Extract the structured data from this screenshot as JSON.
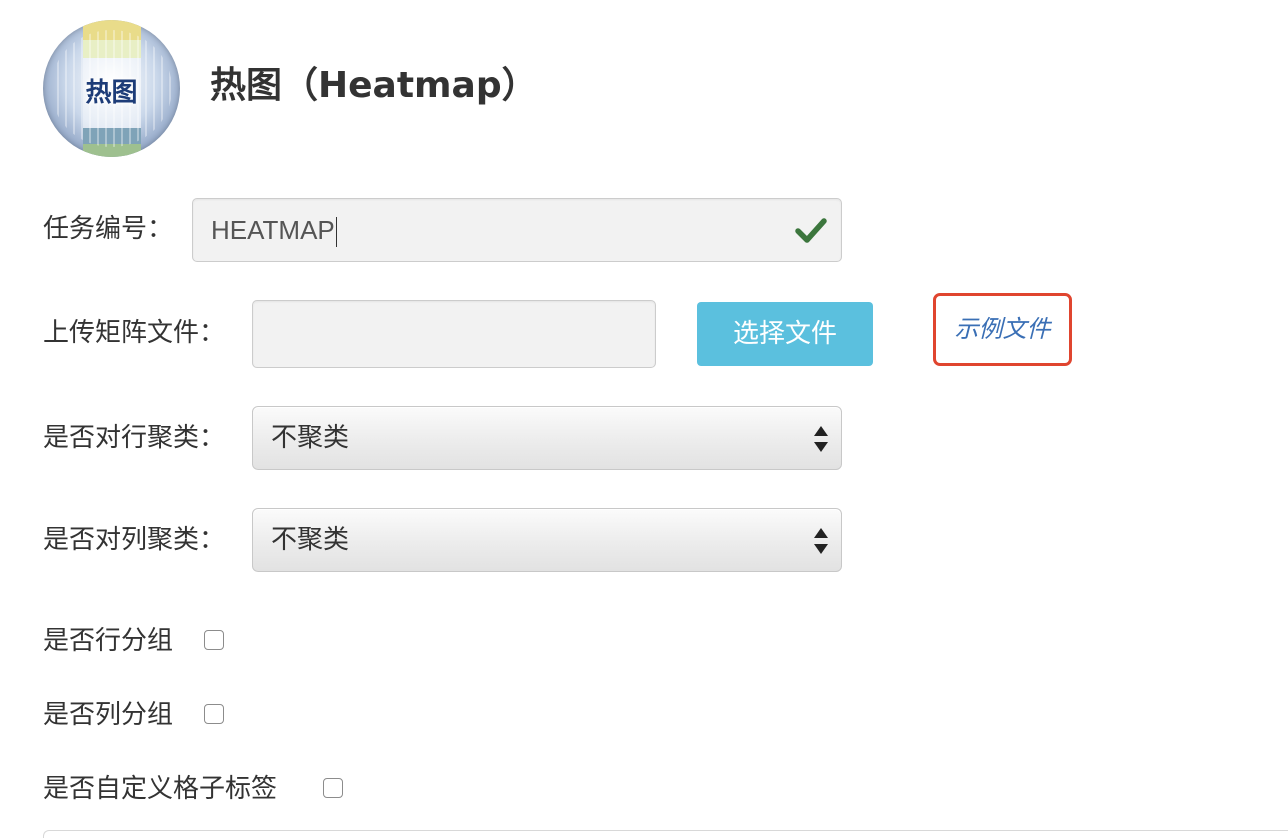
{
  "header": {
    "logo_text": "热图",
    "title": "热图（Heatmap）"
  },
  "form": {
    "task": {
      "label": "任务编号：",
      "value": "HEATMAP",
      "status_icon": "check-icon",
      "status_color": "#3c763d"
    },
    "upload": {
      "label": "上传矩阵文件：",
      "value": "",
      "choose_button_label": "选择文件",
      "example_link_label": "示例文件",
      "button_color": "#5bc0de",
      "highlight_color": "#e0452f"
    },
    "row_cluster": {
      "label": "是否对行聚类：",
      "selected": "不聚类"
    },
    "col_cluster": {
      "label": "是否对列聚类：",
      "selected": "不聚类"
    },
    "row_group": {
      "label": "是否行分组",
      "checked": false
    },
    "col_group": {
      "label": "是否列分组",
      "checked": false
    },
    "custom_cell_labels": {
      "label": "是否自定义格子标签",
      "checked": false
    }
  }
}
